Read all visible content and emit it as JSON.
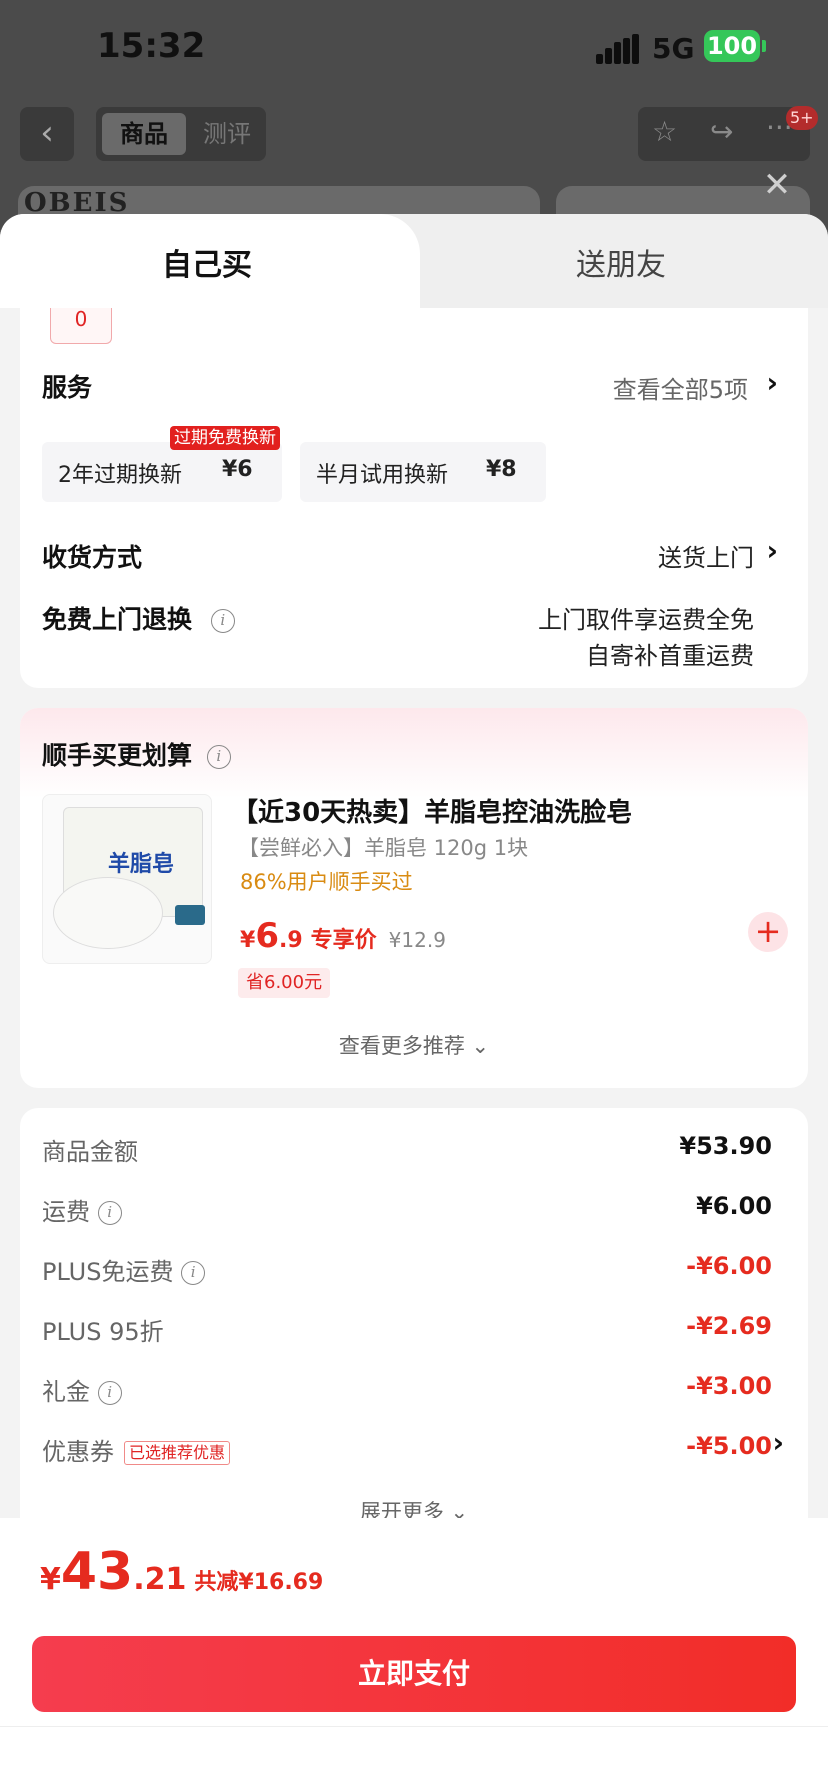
{
  "status_bar": {
    "time": "15:32",
    "network": "5G",
    "battery": "100"
  },
  "background_page": {
    "segment_active": "商品",
    "segment_inactive": "测评",
    "badge": "5+",
    "logo_text": "OBEIS"
  },
  "sheet_tabs": {
    "self": "自己买",
    "gift": "送朋友"
  },
  "quantity": "0",
  "service": {
    "title": "服务",
    "view_all": "查看全部5项",
    "options": [
      {
        "name": "2年过期换新",
        "price": "¥6",
        "tag": "过期免费换新"
      },
      {
        "name": "半月试用换新",
        "price": "¥8"
      }
    ]
  },
  "delivery": {
    "title": "收货方式",
    "value": "送货上门"
  },
  "free_return": {
    "title": "免费上门退换",
    "line1": "上门取件享运费全免",
    "line2": "自寄补首重运费"
  },
  "addon": {
    "title": "顺手买更划算",
    "product": {
      "title": "【近30天热卖】羊脂皂控油洗脸皂",
      "subtitle": "【尝鲜必入】羊脂皂 120g 1块",
      "hint": "86%用户顺手买过",
      "price_currency": "¥",
      "price_int": "6",
      "price_dec": ".9",
      "price_label": "专享价",
      "original_price": "¥12.9",
      "save": "省6.00元",
      "image_brand": "羊脂皂"
    },
    "more": "查看更多推荐"
  },
  "fees": [
    {
      "label": "商品金额",
      "value": "¥53.90",
      "info": false,
      "red": false
    },
    {
      "label": "运费",
      "value": "¥6.00",
      "info": true,
      "red": false
    },
    {
      "label": "PLUS免运费",
      "value": "-¥6.00",
      "info": true,
      "red": true
    },
    {
      "label": "PLUS 95折",
      "value": "-¥2.69",
      "info": false,
      "red": true
    },
    {
      "label": "礼金",
      "value": "-¥3.00",
      "info": true,
      "red": true
    },
    {
      "label": "优惠券",
      "value": "-¥5.00",
      "info": false,
      "red": true,
      "tag": "已选推荐优惠"
    }
  ],
  "expand_more": "展开更多",
  "total": {
    "currency": "¥",
    "int": "43",
    "dec": ".21",
    "saved": "共减¥16.69"
  },
  "pay_button": "立即支付",
  "colors": {
    "accent": "#e52b1f",
    "pay_gradient_start": "#f53d4e",
    "pay_gradient_end": "#f22d28"
  }
}
